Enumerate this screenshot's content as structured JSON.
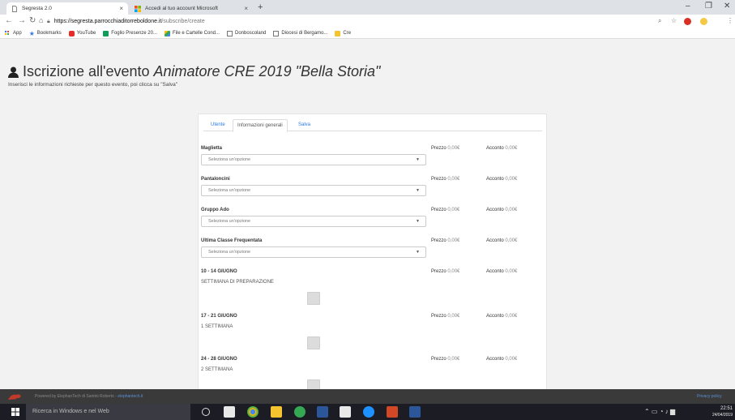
{
  "browser": {
    "tabs": [
      {
        "title": "Segresta 2.0",
        "active": true
      },
      {
        "title": "Accedi al tuo account Microsoft",
        "active": false
      }
    ],
    "new_tab": "+",
    "url_host": "https://segresta.parrocchiaditorreboldone.it",
    "url_path": "/subscribe/create",
    "bookmarks": [
      "App",
      "Bookmarks",
      "YouTube",
      "Foglio Presenze 20...",
      "File e Cartelle Cond...",
      "Donboscoland",
      "Diocesi di Bergamo...",
      "Cre"
    ]
  },
  "page": {
    "title": "Iscrizione all'evento",
    "event_name": "Animatore CRE 2019 \"Bella Storia\"",
    "intro": "Inserisci le informazioni richieste per questo evento, poi clicca su \"Salva\""
  },
  "form": {
    "tabs": [
      "Utente",
      "Informazioni generali",
      "Salva"
    ],
    "price_label": "Prezzo",
    "acconto_label": "Acconto",
    "price_value": "0,00€",
    "placeholder": "Seleziona un'opzione",
    "selects": [
      {
        "label": "Maglietta"
      },
      {
        "label": "Pantaloncini"
      },
      {
        "label": "Gruppo Ado"
      },
      {
        "label": "Ultima Classe Frequentata"
      }
    ],
    "weeks": [
      {
        "label": "10 - 14 GIUGNO",
        "sub": "SETTIMANA DI PREPARAZIONE"
      },
      {
        "label": "17 - 21 GIUGNO",
        "sub": "1 SETTIMANA"
      },
      {
        "label": "24 - 28 GIUGNO",
        "sub": "2 SETTIMANA"
      }
    ]
  },
  "footer": {
    "powered": "Powered by ElephanTech di Santini Roberto - ",
    "link": "elephantech.it",
    "privacy": "Privacy policy"
  },
  "taskbar": {
    "search": "Ricerca in Windows e nel Web",
    "time": "22:51",
    "date": "24/04/2019"
  }
}
